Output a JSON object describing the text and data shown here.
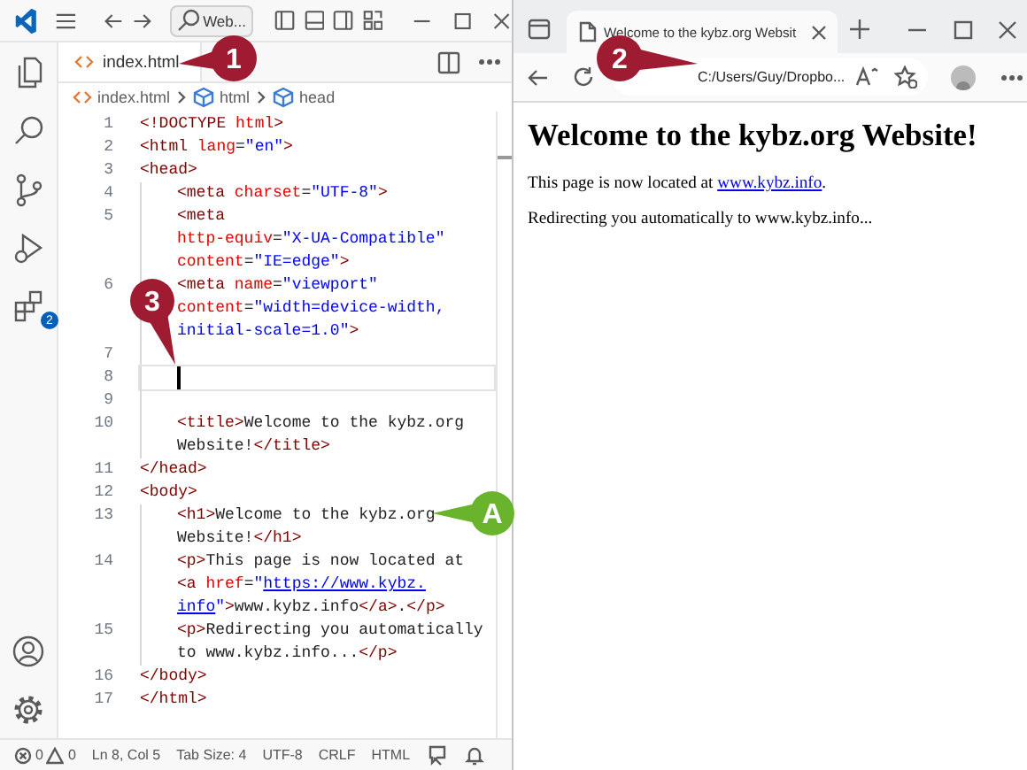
{
  "editor": {
    "title_bar": {
      "search": "Web..."
    },
    "activity_bar": {
      "badge": "2"
    },
    "tab": {
      "label": "index.html",
      "selected": true
    },
    "breadcrumb": [
      "index.html",
      "html",
      "head"
    ],
    "lines": [
      {
        "number": "1",
        "nested": false,
        "current": false,
        "rows": [
          {
            "segments": [
              {
                "kind": "tag",
                "text": "<!DOCTYPE "
              },
              {
                "kind": "attr",
                "text": "html"
              },
              {
                "kind": "tag",
                "text": ">"
              }
            ]
          }
        ]
      },
      {
        "number": "2",
        "nested": false,
        "current": false,
        "rows": [
          {
            "segments": [
              {
                "kind": "tag",
                "text": "<html "
              },
              {
                "kind": "attr",
                "text": "lang"
              },
              {
                "kind": "text",
                "text": "="
              },
              {
                "kind": "value",
                "text": "\"en\""
              },
              {
                "kind": "tag",
                "text": ">"
              }
            ]
          }
        ]
      },
      {
        "number": "3",
        "nested": false,
        "current": false,
        "rows": [
          {
            "segments": [
              {
                "kind": "tag",
                "text": "<head>"
              }
            ]
          }
        ]
      },
      {
        "number": "4",
        "nested": true,
        "current": false,
        "rows": [
          {
            "segments": [
              {
                "kind": "tag",
                "text": "<meta "
              },
              {
                "kind": "attr",
                "text": "charset"
              },
              {
                "kind": "text",
                "text": "="
              },
              {
                "kind": "value",
                "text": "\"UTF-8\""
              },
              {
                "kind": "tag",
                "text": ">"
              }
            ]
          }
        ]
      },
      {
        "number": "5",
        "nested": true,
        "current": false,
        "rows": [
          {
            "segments": [
              {
                "kind": "tag",
                "text": "<meta"
              }
            ]
          },
          {
            "segments": [
              {
                "kind": "attr",
                "text": "http-equiv"
              },
              {
                "kind": "text",
                "text": "="
              },
              {
                "kind": "value",
                "text": "\"X-UA-Compatible\""
              }
            ]
          },
          {
            "segments": [
              {
                "kind": "attr",
                "text": "content"
              },
              {
                "kind": "text",
                "text": "="
              },
              {
                "kind": "value",
                "text": "\"IE=edge\""
              },
              {
                "kind": "tag",
                "text": ">"
              }
            ]
          }
        ]
      },
      {
        "number": "6",
        "nested": true,
        "current": false,
        "rows": [
          {
            "segments": [
              {
                "kind": "tag",
                "text": "<meta "
              },
              {
                "kind": "attr",
                "text": "name"
              },
              {
                "kind": "text",
                "text": "="
              },
              {
                "kind": "value",
                "text": "\"viewport\""
              }
            ]
          },
          {
            "segments": [
              {
                "kind": "attr",
                "text": "content"
              },
              {
                "kind": "text",
                "text": "="
              },
              {
                "kind": "value",
                "text": "\"width=device-width,"
              }
            ]
          },
          {
            "segments": [
              {
                "kind": "value",
                "text": "initial-scale=1.0\""
              },
              {
                "kind": "tag",
                "text": ">"
              }
            ]
          }
        ]
      },
      {
        "number": "7",
        "nested": true,
        "current": false
      },
      {
        "number": "8",
        "nested": true,
        "current": true
      },
      {
        "number": "9",
        "nested": true,
        "current": false
      },
      {
        "number": "10",
        "nested": true,
        "current": false,
        "rows": [
          {
            "segments": [
              {
                "kind": "tag",
                "text": "<title>"
              },
              {
                "kind": "text",
                "text": "Welcome to the kybz.org"
              }
            ]
          },
          {
            "segments": [
              {
                "kind": "text",
                "text": "Website!"
              },
              {
                "kind": "tag",
                "text": "</title>"
              }
            ]
          }
        ]
      },
      {
        "number": "11",
        "nested": false,
        "current": false,
        "rows": [
          {
            "segments": [
              {
                "kind": "tag",
                "text": "</head>"
              }
            ]
          }
        ]
      },
      {
        "number": "12",
        "nested": false,
        "current": false,
        "rows": [
          {
            "segments": [
              {
                "kind": "tag",
                "text": "<body>"
              }
            ]
          }
        ]
      },
      {
        "number": "13",
        "nested": true,
        "current": false,
        "rows": [
          {
            "segments": [
              {
                "kind": "tag",
                "text": "<h1>"
              },
              {
                "kind": "text",
                "text": "Welcome to the kybz.org"
              }
            ]
          },
          {
            "segments": [
              {
                "kind": "text",
                "text": "Website!"
              },
              {
                "kind": "tag",
                "text": "</h1>"
              }
            ]
          }
        ]
      },
      {
        "number": "14",
        "nested": true,
        "current": false,
        "rows": [
          {
            "segments": [
              {
                "kind": "tag",
                "text": "<p>"
              },
              {
                "kind": "text",
                "text": "This page is now located at"
              }
            ]
          },
          {
            "segments": [
              {
                "kind": "tag",
                "text": "<a "
              },
              {
                "kind": "attr",
                "text": "href"
              },
              {
                "kind": "text",
                "text": "="
              },
              {
                "kind": "value",
                "text": "\""
              },
              {
                "kind": "link",
                "text": "https://www.kybz."
              }
            ]
          },
          {
            "segments": [
              {
                "kind": "link",
                "text": "info"
              },
              {
                "kind": "value",
                "text": "\""
              },
              {
                "kind": "tag",
                "text": ">"
              },
              {
                "kind": "text",
                "text": "www.kybz.info"
              },
              {
                "kind": "tag",
                "text": "</a>"
              },
              {
                "kind": "text",
                "text": "."
              },
              {
                "kind": "tag",
                "text": "</p>"
              }
            ]
          }
        ]
      },
      {
        "number": "15",
        "nested": true,
        "current": false,
        "rows": [
          {
            "segments": [
              {
                "kind": "tag",
                "text": "<p>"
              },
              {
                "kind": "text",
                "text": "Redirecting you automatically"
              }
            ]
          },
          {
            "segments": [
              {
                "kind": "text",
                "text": "to www.kybz.info..."
              },
              {
                "kind": "tag",
                "text": "</p>"
              }
            ]
          }
        ]
      },
      {
        "number": "16",
        "nested": false,
        "current": false,
        "rows": [
          {
            "segments": [
              {
                "kind": "tag",
                "text": "</body>"
              }
            ]
          }
        ]
      },
      {
        "number": "17",
        "nested": false,
        "current": false,
        "rows": [
          {
            "segments": [
              {
                "kind": "tag",
                "text": "</html>"
              }
            ]
          }
        ]
      }
    ],
    "status_bar": {
      "errors": "0",
      "warnings": "0",
      "items": [
        "Ln 8, Col 5",
        "Tab Size: 4",
        "UTF-8",
        "CRLF",
        "HTML"
      ]
    }
  },
  "browser": {
    "tab": {
      "title": "Welcome to the kybz.org Websit",
      "selected": true
    },
    "address": "C:/Users/Guy/Dropbo...",
    "page": {
      "heading": "Welcome to the kybz.org Website!",
      "paragraphs": [
        [
          {
            "kind": "text",
            "text": "This page is now located at "
          },
          {
            "kind": "link",
            "text": "www.kybz.info"
          },
          {
            "kind": "text",
            "text": "."
          }
        ],
        [
          {
            "kind": "text",
            "text": "Redirecting you automatically to www.kybz.info..."
          }
        ]
      ]
    }
  },
  "callouts": [
    {
      "label": "1",
      "color": "#9e1b32"
    },
    {
      "label": "2",
      "color": "#9e1b32"
    },
    {
      "label": "3",
      "color": "#9e1b32"
    },
    {
      "label": "A",
      "color": "#6ab42d"
    }
  ]
}
